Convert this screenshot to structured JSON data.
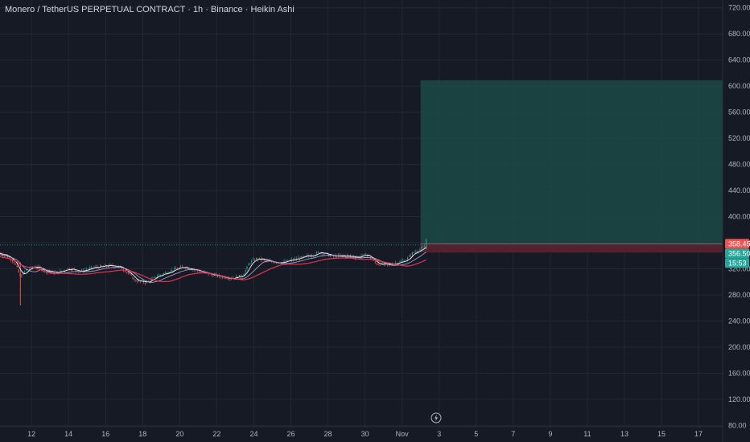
{
  "chart_title": "Monero / TetherUS PERPETUAL CONTRACT · 1h · Binance · Heikin Ashi",
  "colors": {
    "background": "#161a25",
    "grid": "#232734",
    "up": "#26a69a",
    "down": "#ef5350",
    "profit_zone": "#1b4a45",
    "loss_zone": "#5a2430",
    "ma_fast": "#ffffff",
    "ma_mid": "#b39ddb",
    "ma_slow": "#e53950",
    "text": "#b2b5be"
  },
  "icons": {
    "replay": "lightning-bolt-icon"
  },
  "chart_data": {
    "type": "candlestick",
    "title": "Monero / TetherUS PERPETUAL CONTRACT · 1h · Binance · Heikin Ashi",
    "x_tick_labels": [
      "12",
      "14",
      "16",
      "18",
      "20",
      "22",
      "24",
      "26",
      "28",
      "30",
      "Nov",
      "3",
      "5",
      "7",
      "9",
      "11",
      "13",
      "15",
      "17"
    ],
    "x_tick_days": [
      12,
      14,
      16,
      18,
      20,
      22,
      24,
      26,
      28,
      30,
      32,
      34,
      36,
      38,
      40,
      42,
      44,
      46,
      48
    ],
    "x_range_days": [
      10.3,
      49.3
    ],
    "y_ticks": [
      80,
      120,
      160,
      200,
      240,
      280,
      320,
      360,
      400,
      440,
      480,
      520,
      560,
      600,
      640,
      680,
      720
    ],
    "y_tick_labels": [
      "80.00",
      "120.00",
      "160.00",
      "200.00",
      "240.00",
      "280.00",
      "320.00",
      "360.00",
      "400.00",
      "440.00",
      "480.00",
      "520.00",
      "560.00",
      "600.00",
      "640.00",
      "680.00",
      "720.00"
    ],
    "ylim": [
      78,
      732
    ],
    "price_path": [
      [
        10.3,
        344
      ],
      [
        10.6,
        341
      ],
      [
        11.0,
        333
      ],
      [
        11.2,
        322
      ],
      [
        11.4,
        307
      ],
      [
        11.7,
        318
      ],
      [
        12.2,
        324
      ],
      [
        12.8,
        316
      ],
      [
        13.4,
        314
      ],
      [
        14.0,
        321
      ],
      [
        14.6,
        316
      ],
      [
        15.4,
        322
      ],
      [
        16.2,
        325
      ],
      [
        16.8,
        323
      ],
      [
        17.2,
        314
      ],
      [
        17.6,
        302
      ],
      [
        18.2,
        299
      ],
      [
        18.8,
        309
      ],
      [
        19.6,
        318
      ],
      [
        20.2,
        323
      ],
      [
        20.8,
        319
      ],
      [
        21.4,
        313
      ],
      [
        22.2,
        308
      ],
      [
        22.8,
        306
      ],
      [
        23.4,
        310
      ],
      [
        23.8,
        330
      ],
      [
        24.2,
        336
      ],
      [
        24.8,
        331
      ],
      [
        25.6,
        330
      ],
      [
        26.4,
        336
      ],
      [
        27.0,
        340
      ],
      [
        27.6,
        346
      ],
      [
        28.2,
        339
      ],
      [
        28.8,
        340
      ],
      [
        29.6,
        338
      ],
      [
        30.1,
        342
      ],
      [
        30.6,
        328
      ],
      [
        31.2,
        326
      ],
      [
        31.8,
        330
      ],
      [
        32.2,
        333
      ],
      [
        32.6,
        345
      ],
      [
        33.0,
        350
      ],
      [
        33.2,
        353
      ],
      [
        33.35,
        356.5
      ]
    ],
    "moving_averages": [
      {
        "color_key": "ma_fast",
        "period": 5
      },
      {
        "color_key": "ma_mid",
        "period": 12
      },
      {
        "color_key": "ma_slow",
        "period": 24
      }
    ],
    "position": {
      "type": "long",
      "start_day": 33.0,
      "end_day": 49.3,
      "entry": 358.45,
      "stop": 345,
      "target": 609
    },
    "price_tags": [
      {
        "label": "358.45",
        "value": 358.45,
        "color": "#ef5350"
      },
      {
        "label": "356.50",
        "value": 356.5,
        "color": "#26a69a"
      },
      {
        "label": "15:53",
        "value": 347.5,
        "color": "#26a69a"
      }
    ],
    "last_price": 356.5,
    "grid": true,
    "legend": "none"
  }
}
